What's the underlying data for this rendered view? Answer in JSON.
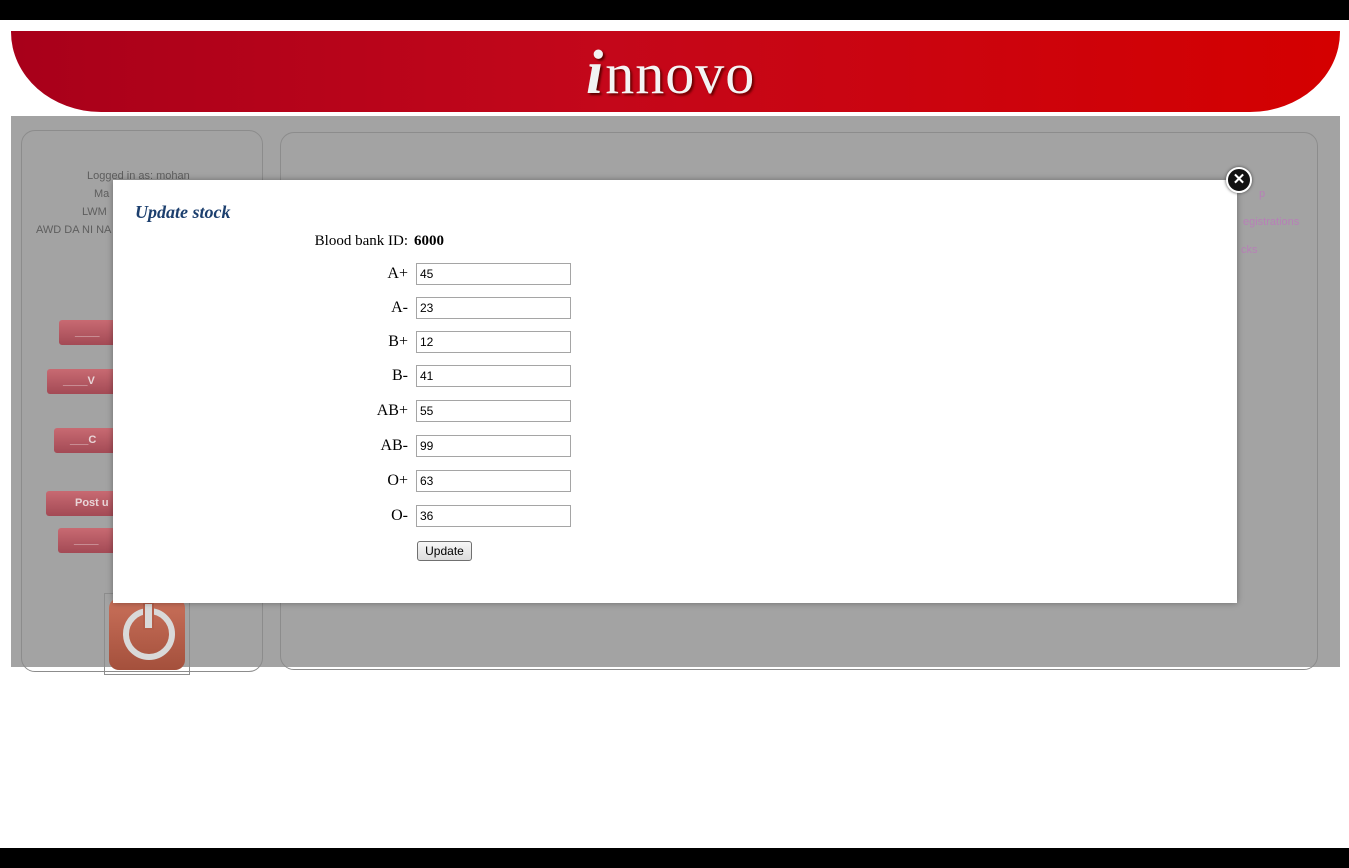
{
  "header": {
    "logo_letter": "i",
    "logo_text": "nnovo"
  },
  "background": {
    "user_lines": [
      "Logged in as: mohan",
      "Ma",
      "LWM",
      "AWD DA NI NA"
    ],
    "side_buttons": [
      "____",
      "____V",
      "___C",
      "Post u",
      "____"
    ],
    "right_links": [
      "p",
      "egistrations",
      "cks"
    ]
  },
  "modal": {
    "title": "Update stock",
    "close_symbol": "✕",
    "blood_bank_label": "Blood bank ID:",
    "blood_bank_id": "6000",
    "fields": [
      {
        "label": "A+",
        "value": "45"
      },
      {
        "label": "A-",
        "value": "23"
      },
      {
        "label": "B+",
        "value": "12"
      },
      {
        "label": "B-",
        "value": "41"
      },
      {
        "label": "AB+",
        "value": "55"
      },
      {
        "label": "AB-",
        "value": "99"
      },
      {
        "label": "O+",
        "value": "63"
      },
      {
        "label": "O-",
        "value": "36"
      }
    ],
    "submit_label": "Update"
  }
}
